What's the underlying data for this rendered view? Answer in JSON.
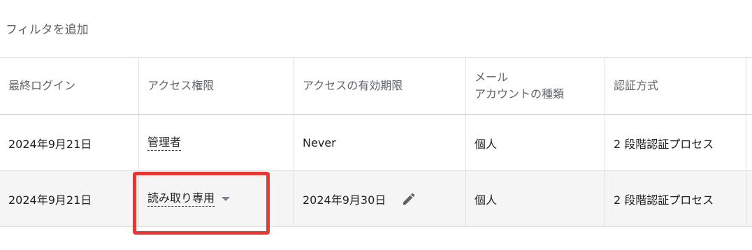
{
  "filter": {
    "placeholder": "フィルタを追加"
  },
  "columns": [
    "最終ログイン",
    "アクセス権限",
    "アクセスの有効期限",
    "メール",
    "アカウントの種類",
    "認証方式"
  ],
  "rows": [
    {
      "last_login": "2024年9月21日",
      "access": "管理者",
      "expiry": "Never",
      "account_type": "個人",
      "auth": "2 段階認証プロセス"
    },
    {
      "last_login": "2024年9月21日",
      "access": "読み取り専用",
      "expiry": "2024年9月30日",
      "account_type": "個人",
      "auth": "2 段階認証プロセス"
    }
  ],
  "icons": {
    "dropdown": "chevron-down-icon",
    "edit": "pencil-icon"
  },
  "colors": {
    "highlight": "#e53935",
    "alt_row": "#f5f5f5",
    "header_text": "#5f6368"
  }
}
